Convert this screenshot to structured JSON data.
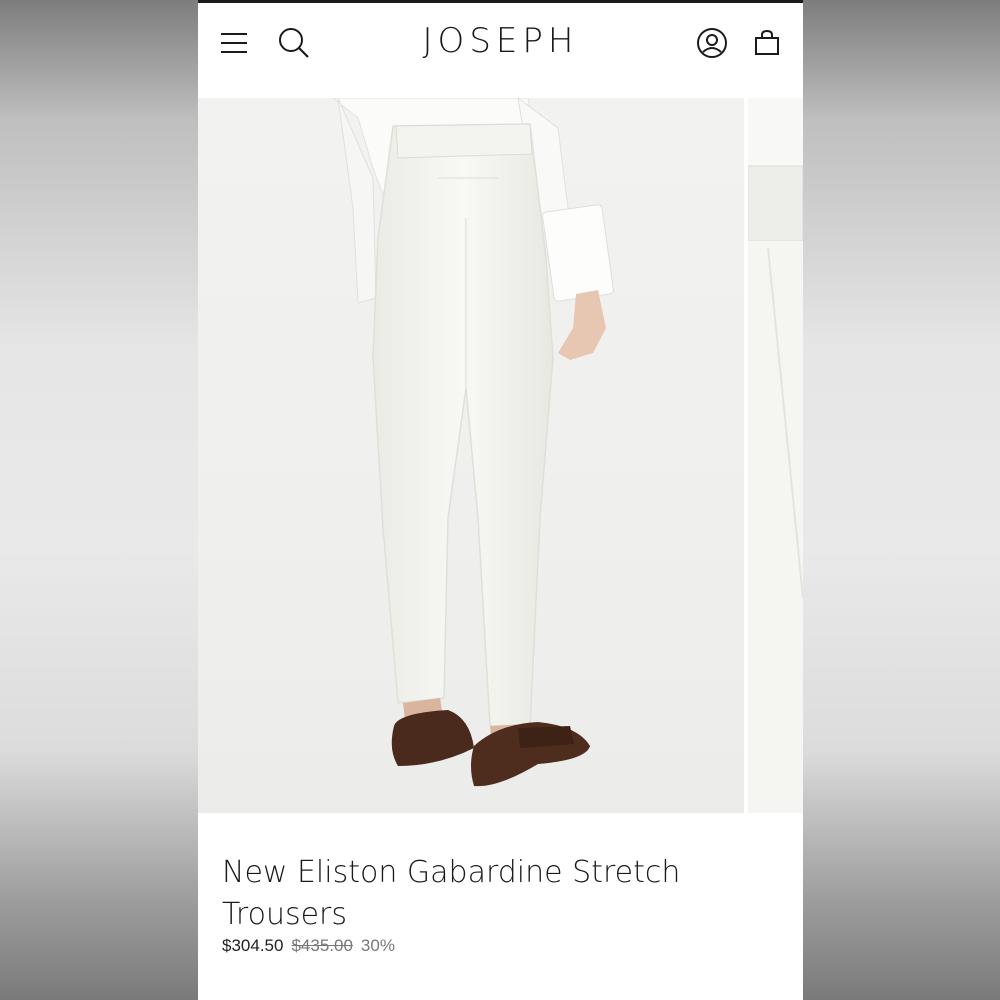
{
  "header": {
    "logo": "JOSEPH",
    "icons": [
      "menu-icon",
      "search-icon",
      "account-icon",
      "shopping-bag-icon"
    ]
  },
  "product": {
    "title": "New Eliston Gabardine Stretch Trousers",
    "price": "$304.50",
    "original_price": "$435.00",
    "discount": "30%"
  },
  "colors": {
    "text": "#1a1a1a",
    "muted": "#777777",
    "photo_bg": "#f0f0ee",
    "trousers": "#f7f7f3",
    "loafer": "#4a2a1c"
  }
}
